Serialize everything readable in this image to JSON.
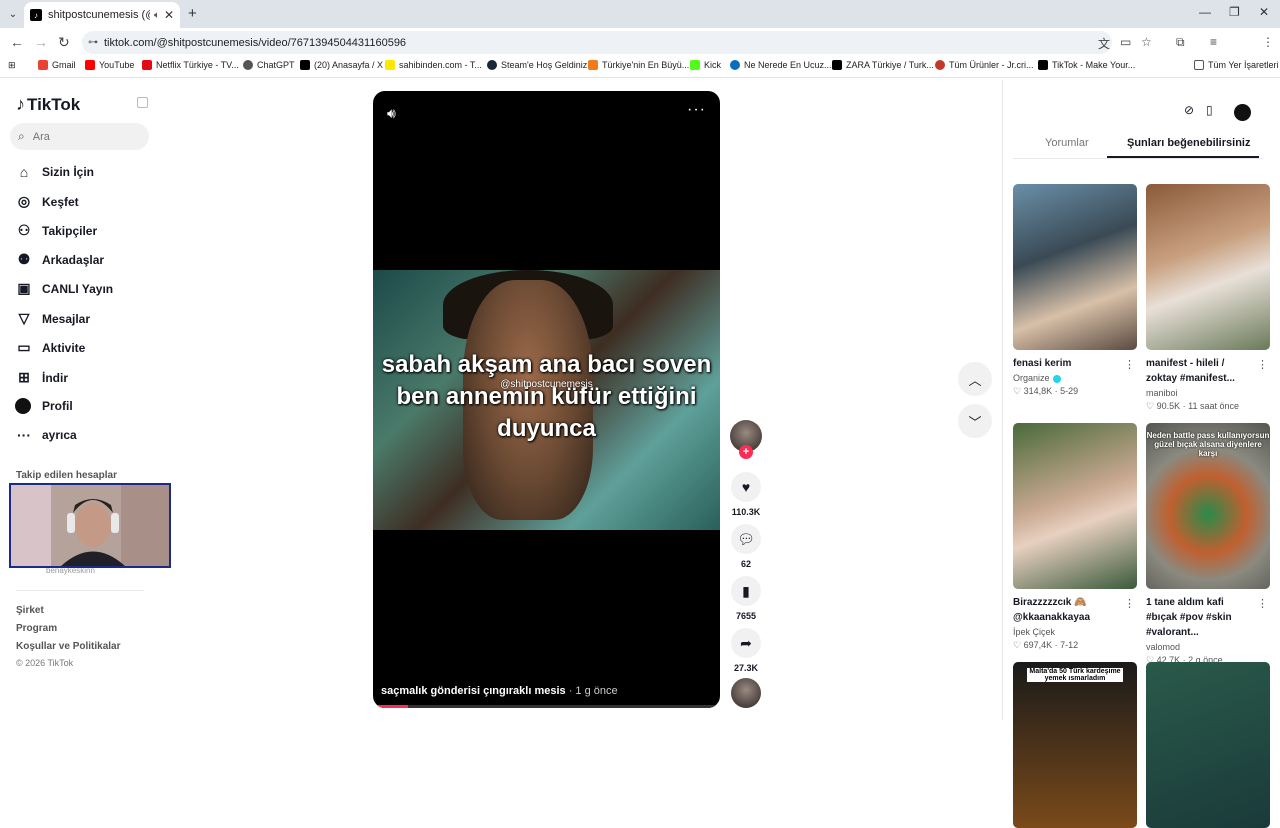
{
  "browser": {
    "tab_title": "shitpostcunemesis (@shitp",
    "url": "tiktok.com/@shitpostcunemesis/video/7671394504431160596",
    "bookmarks": [
      {
        "label": "Gmail",
        "color": "#ea4335"
      },
      {
        "label": "YouTube",
        "color": "#ff0000"
      },
      {
        "label": "Netflix Türkiye - TV...",
        "color": "#e50914"
      },
      {
        "label": "ChatGPT",
        "color": "#555555"
      },
      {
        "label": "(20) Anasayfa / X",
        "color": "#000000"
      },
      {
        "label": "sahibinden.com - T...",
        "color": "#ffe800"
      },
      {
        "label": "Steam'e Hoş Geldiniz",
        "color": "#1b2838"
      },
      {
        "label": "Türkiye'nin En Büyü...",
        "color": "#f27a1a"
      },
      {
        "label": "Kick",
        "color": "#53fc18"
      },
      {
        "label": "Ne Nerede En Ucuz...",
        "color": "#0a6ebd"
      },
      {
        "label": "ZARA Türkiye / Turk...",
        "color": "#000000"
      },
      {
        "label": "Tüm Ürünler - Jr.cri...",
        "color": "#c0392b"
      },
      {
        "label": "TikTok - Make Your...",
        "color": "#000000"
      }
    ],
    "all_bookmarks": "Tüm Yer İşaretleri"
  },
  "sidebar": {
    "logo": "TikTok",
    "search_placeholder": "Ara",
    "items": [
      {
        "label": "Sizin İçin",
        "icon": "home-icon",
        "glyph": "⌂"
      },
      {
        "label": "Keşfet",
        "icon": "compass-icon",
        "glyph": "◎"
      },
      {
        "label": "Takipçiler",
        "icon": "following-icon",
        "glyph": "⚇"
      },
      {
        "label": "Arkadaşlar",
        "icon": "friends-icon",
        "glyph": "⚉"
      },
      {
        "label": "CANLI Yayın",
        "icon": "live-icon",
        "glyph": "▣"
      },
      {
        "label": "Mesajlar",
        "icon": "messages-icon",
        "glyph": "▽"
      },
      {
        "label": "Aktivite",
        "icon": "activity-icon",
        "glyph": "▭"
      },
      {
        "label": "İndir",
        "icon": "download-icon",
        "glyph": "⊞"
      },
      {
        "label": "Profil",
        "icon": "profile-icon",
        "glyph": ""
      },
      {
        "label": "ayrıca",
        "icon": "more-icon",
        "glyph": "···"
      }
    ],
    "followed_title": "Takip edilen hesaplar",
    "followed_partial": "benaykeskinn",
    "footer_links": [
      "Şirket",
      "Program",
      "Koşullar ve Politikalar"
    ],
    "copyright": "© 2026 TikTok"
  },
  "video": {
    "caption": "sabah akşam ana bacı soven ben annemin küfür ettiğini duyunca",
    "watermark": "@shitpostcunemesis",
    "description": "saçmalık gönderisi çıngıraklı mesis",
    "ago": " · 1 g önce",
    "progress": 0.1
  },
  "actions": {
    "likes": "110.3K",
    "comments": "62",
    "saves": "7655",
    "shares": "27.3K"
  },
  "right_panel": {
    "tabs": [
      "Yorumlar",
      "Şunları beğenebilirsiniz"
    ],
    "cards": [
      {
        "title": "fenasi kerim",
        "author": "Organize",
        "verified": true,
        "likes": "314,8K",
        "date": "5-29",
        "thumb": "linear-gradient(160deg,#6a8fa8,#3a4a55 40%,#d8c0a8 70%,#5a4a40)"
      },
      {
        "title": "manifest - hileli / zoktay #manifest...",
        "author": "maniboi",
        "verified": false,
        "likes": "90.5K",
        "date": "11 saat önce",
        "thumb": "linear-gradient(160deg,#8a5a3a,#c8a080 40%,#e8e0d8 60%,#6a7a5a)"
      },
      {
        "title": "Birazzzzzcık 🙈 @kkaanakkayaa",
        "author": "İpek Çiçek",
        "verified": false,
        "likes": "697,4K",
        "date": "7-12",
        "thumb": "linear-gradient(160deg,#4a6a3a,#c8a890 45%,#e8d0c0 60%,#3a5a3a)"
      },
      {
        "title": "1 tane aldım kafi #bıçak #pov #skin #valorant...",
        "author": "valomod",
        "verified": false,
        "likes": "42.7K",
        "date": "2 g önce",
        "thumb": "radial-gradient(circle at 50% 55%,#2a8a4a 0%,#c06030 35%,#8a8a80 60%,#555550 100%)",
        "overlay": "Neden battle pass kullanıyorsun güzel bıçak alsana diyenlere karşı"
      },
      {
        "title": "",
        "author": "",
        "verified": false,
        "likes": "",
        "date": "",
        "thumb": "linear-gradient(180deg,#1a1a1a,#7a4a1a)",
        "overlay": "Malta'da 50 Türk kardeşime yemek ısmarladım"
      },
      {
        "title": "",
        "author": "",
        "verified": false,
        "likes": "",
        "date": "",
        "thumb": "linear-gradient(160deg,#2a5a4a,#1a3a3a)"
      }
    ]
  }
}
